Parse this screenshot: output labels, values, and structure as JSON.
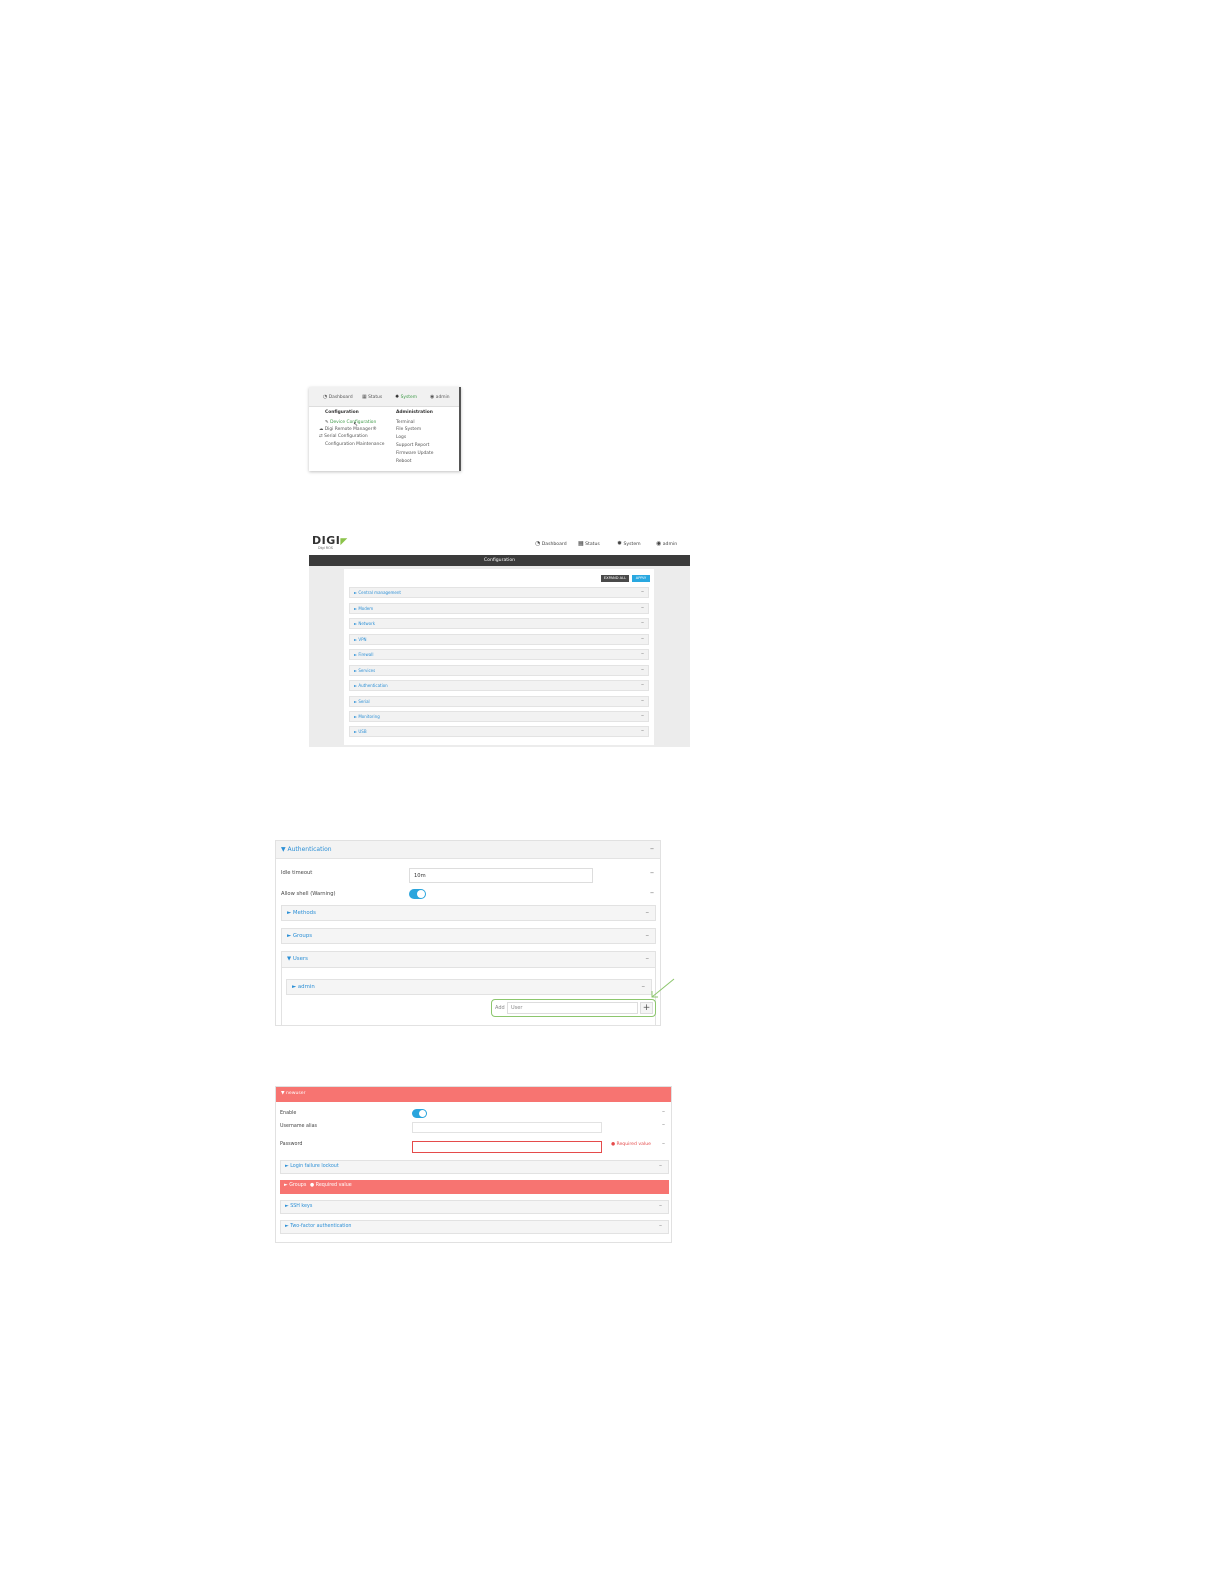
{
  "menu_screenshot": {
    "nav": {
      "dashboard": "Dashboard",
      "status": "Status",
      "system": "System",
      "admin": "admin"
    },
    "configuration_header": "Configuration",
    "configuration_items": [
      "Device Configuration",
      "Digi Remote Manager®",
      "Serial Configuration",
      "Configuration Maintenance"
    ],
    "administration_header": "Administration",
    "administration_items": [
      "Terminal",
      "File System",
      "Logs",
      "Support Report",
      "Firmware Update",
      "Reboot"
    ]
  },
  "config_screenshot": {
    "logo": "DIGI",
    "logo_sub": "Digi ROS",
    "nav": {
      "dashboard": "Dashboard",
      "status": "Status",
      "system": "System",
      "admin": "admin"
    },
    "title": "Configuration",
    "expand_all": "EXPAND ALL",
    "apply": "APPLY",
    "sections": [
      "► Central management",
      "► Modem",
      "► Network",
      "► VPN",
      "► Firewall",
      "► Services",
      "► Authentication",
      "► Serial",
      "► Monitoring",
      "► USB"
    ]
  },
  "auth_screenshot": {
    "section_title": "▼ Authentication",
    "idle_timeout_label": "Idle timeout",
    "idle_timeout_value": "10m",
    "allow_shell_label": "Allow shell (Warning)",
    "methods": "► Methods",
    "groups": "► Groups",
    "users": "▼ Users",
    "admin_user": "► admin",
    "add_label": "Add",
    "add_placeholder": "User",
    "add_icon_glyph": "+"
  },
  "user_screenshot": {
    "header": "▼ newuser",
    "enable_label": "Enable",
    "username_alias_label": "Username alias",
    "password_label": "Password",
    "required_value": "Required value",
    "login_failure_lockout": "► Login failure lockout",
    "groups": "► Groups",
    "groups_error": "Required value",
    "ssh_keys": "► SSH keys",
    "two_factor": "► Two-factor authentication"
  },
  "colors": {
    "accent_blue": "#2b8fd6",
    "toggle_blue": "#2aa5dd",
    "error_red": "#f77471",
    "digi_green": "#8bc34a"
  }
}
